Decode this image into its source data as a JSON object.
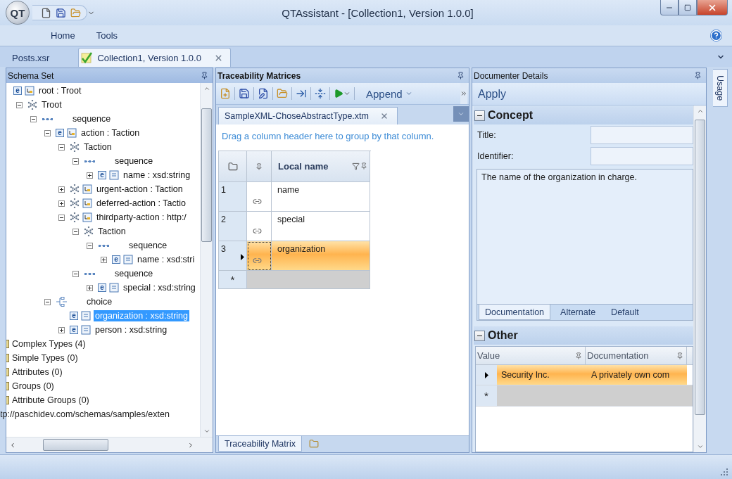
{
  "window": {
    "title": "QTAssistant - [Collection1, Version 1.0.0]",
    "logo": "QT"
  },
  "ribbon_tabs": [
    "Home",
    "Tools"
  ],
  "document_tabs": [
    {
      "label": "Posts.xsr",
      "selected": false
    },
    {
      "label": "Collection1, Version 1.0.0",
      "selected": true
    }
  ],
  "schema_set": {
    "title": "Schema Set",
    "tree": [
      {
        "kind": "element-complex",
        "badge": "e",
        "label": "root : Troot",
        "selected": false,
        "children": [
          {
            "kind": "complex-type",
            "label": "Troot",
            "expanded": true,
            "selected": false,
            "children": [
              {
                "kind": "sequence",
                "label": "sequence",
                "expanded": true,
                "selected": false,
                "children": [
                  {
                    "kind": "element-complex",
                    "badge": "e",
                    "label": "action : Taction",
                    "expanded": true,
                    "selected": false,
                    "children": [
                      {
                        "kind": "complex-type",
                        "label": "Taction",
                        "expanded": true,
                        "selected": false,
                        "children": [
                          {
                            "kind": "sequence",
                            "label": "sequence",
                            "expanded": true,
                            "selected": false,
                            "children": [
                              {
                                "kind": "element-simple",
                                "badge": "e",
                                "label": "name : xsd:string",
                                "expanded": false,
                                "selected": false
                              }
                            ]
                          }
                        ]
                      },
                      {
                        "kind": "typed-complex",
                        "label": "urgent-action : Taction",
                        "expanded": false,
                        "selected": false
                      },
                      {
                        "kind": "typed-complex",
                        "label": "deferred-action : Tactio",
                        "expanded": false,
                        "selected": false
                      },
                      {
                        "kind": "typed-complex",
                        "label": "thirdparty-action : http:/",
                        "expanded": true,
                        "selected": false,
                        "children": [
                          {
                            "kind": "complex-type",
                            "label": "Taction",
                            "expanded": true,
                            "selected": false,
                            "children": [
                              {
                                "kind": "sequence",
                                "label": "sequence",
                                "expanded": true,
                                "selected": false,
                                "children": [
                                  {
                                    "kind": "element-simple",
                                    "badge": "e",
                                    "label": "name : xsd:stri",
                                    "expanded": false,
                                    "selected": false
                                  }
                                ]
                              }
                            ]
                          },
                          {
                            "kind": "sequence",
                            "label": "sequence",
                            "expanded": true,
                            "selected": false,
                            "children": [
                              {
                                "kind": "element-simple",
                                "badge": "e",
                                "label": "special : xsd:string",
                                "expanded": false,
                                "selected": false
                              }
                            ]
                          }
                        ]
                      }
                    ]
                  },
                  {
                    "kind": "choice",
                    "label": "choice",
                    "expanded": true,
                    "selected": false,
                    "children": [
                      {
                        "kind": "element-simple",
                        "badge": "e",
                        "label": "organization : xsd:string",
                        "selected": true
                      },
                      {
                        "kind": "element-simple",
                        "badge": "e",
                        "label": "person : xsd:string",
                        "expanded": false,
                        "selected": false
                      }
                    ]
                  }
                ]
              }
            ]
          }
        ]
      }
    ],
    "categories": [
      "Complex Types (4)",
      "Simple Types (0)",
      "Attributes (0)",
      "Groups (0)",
      "Attribute Groups (0)"
    ],
    "namespace": "tp://paschidev.com/schemas/samples/exten"
  },
  "traceability": {
    "title": "Traceability Matrices",
    "append": "Append",
    "document_tab": "SampleXML-ChoseAbstractType.xtm",
    "group_hint": "Drag a column header here to group by that column.",
    "column": "Local name",
    "rows": [
      {
        "number": "1",
        "name": "name",
        "selected": false
      },
      {
        "number": "2",
        "name": "special",
        "selected": false
      },
      {
        "number": "3",
        "name": "organization",
        "selected": true
      }
    ],
    "new_row_marker": "*",
    "bottom_tabs": [
      {
        "label": "Traceability Matrix",
        "selected": true
      }
    ]
  },
  "documenter": {
    "title": "Documenter Details",
    "apply": "Apply",
    "concept": {
      "heading": "Concept",
      "expanded": true,
      "fields": [
        {
          "label": "Title:"
        },
        {
          "label": "Identifier:"
        }
      ],
      "text": "The name of the organization in charge.",
      "tabs": [
        {
          "label": "Documentation",
          "selected": true
        },
        {
          "label": "Alternate",
          "selected": false
        },
        {
          "label": "Default",
          "selected": false
        }
      ]
    },
    "other": {
      "heading": "Other",
      "expanded": true,
      "columns": [
        "Value",
        "Documentation"
      ],
      "rows": [
        {
          "value": "Security Inc.",
          "documentation": "A privately own com",
          "selected": true
        }
      ],
      "new_row_marker": "*"
    },
    "side_tab": "Usage"
  }
}
